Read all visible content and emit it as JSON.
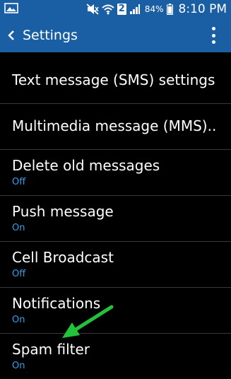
{
  "status_bar": {
    "battery_pct": "84%",
    "time": "8:10 PM",
    "sim_badge": "2"
  },
  "action_bar": {
    "title": "Settings"
  },
  "items": [
    {
      "title": "Text message (SMS) settings",
      "subtitle": ""
    },
    {
      "title": "Multimedia message (MMS)..",
      "subtitle": ""
    },
    {
      "title": "Delete old messages",
      "subtitle": "Off"
    },
    {
      "title": "Push message",
      "subtitle": "On"
    },
    {
      "title": "Cell Broadcast",
      "subtitle": "Off"
    },
    {
      "title": "Notifications",
      "subtitle": "On"
    },
    {
      "title": "Spam filter",
      "subtitle": "On"
    }
  ],
  "colors": {
    "bar_blue": "#1a5fa3",
    "subtitle_blue": "#3a9ee8",
    "arrow_green": "#22c33a",
    "background": "#000000"
  },
  "icons": [
    "image-icon",
    "mute-icon",
    "wifi-icon",
    "sim-2-icon",
    "signal-icon",
    "battery-icon",
    "back-chevron-icon",
    "overflow-menu-icon"
  ]
}
